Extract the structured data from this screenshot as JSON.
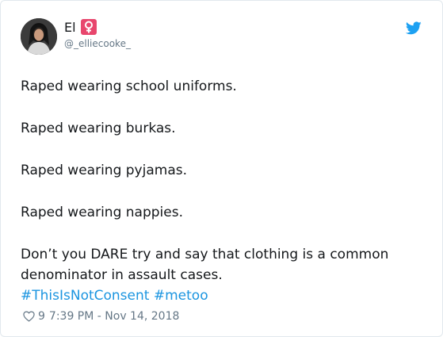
{
  "author": {
    "display_name": "El",
    "handle": "@_elliecooke_",
    "badge_icon": "female-sign-icon",
    "badge_color": "#e8466d"
  },
  "tweet": {
    "lines": [
      "Raped wearing school uniforms.",
      "Raped wearing burkas.",
      "Raped wearing pyjamas.",
      "Raped wearing nappies."
    ],
    "closing_text": "Don’t you DARE try and say that clothing is a common denominator in assault cases.",
    "hashtags": [
      "#ThisIsNotConsent",
      "#metoo"
    ],
    "hashtag_color": "#1b95e0"
  },
  "footer": {
    "like_icon": "heart-icon",
    "like_count": "9",
    "timestamp": "7:39 PM - Nov 14, 2018"
  },
  "brand": {
    "logo_icon": "twitter-bird-icon",
    "logo_color": "#1da1f2"
  }
}
